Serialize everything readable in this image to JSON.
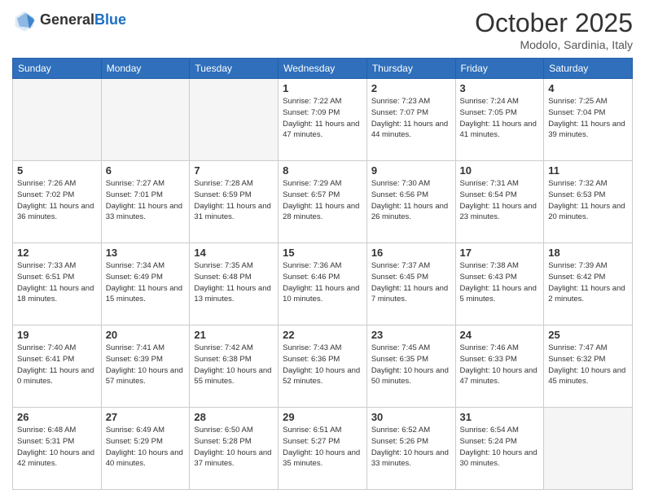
{
  "header": {
    "logo_general": "General",
    "logo_blue": "Blue",
    "month": "October 2025",
    "location": "Modolo, Sardinia, Italy"
  },
  "days_of_week": [
    "Sunday",
    "Monday",
    "Tuesday",
    "Wednesday",
    "Thursday",
    "Friday",
    "Saturday"
  ],
  "weeks": [
    [
      {
        "day": "",
        "info": ""
      },
      {
        "day": "",
        "info": ""
      },
      {
        "day": "",
        "info": ""
      },
      {
        "day": "1",
        "info": "Sunrise: 7:22 AM\nSunset: 7:09 PM\nDaylight: 11 hours and 47 minutes."
      },
      {
        "day": "2",
        "info": "Sunrise: 7:23 AM\nSunset: 7:07 PM\nDaylight: 11 hours and 44 minutes."
      },
      {
        "day": "3",
        "info": "Sunrise: 7:24 AM\nSunset: 7:05 PM\nDaylight: 11 hours and 41 minutes."
      },
      {
        "day": "4",
        "info": "Sunrise: 7:25 AM\nSunset: 7:04 PM\nDaylight: 11 hours and 39 minutes."
      }
    ],
    [
      {
        "day": "5",
        "info": "Sunrise: 7:26 AM\nSunset: 7:02 PM\nDaylight: 11 hours and 36 minutes."
      },
      {
        "day": "6",
        "info": "Sunrise: 7:27 AM\nSunset: 7:01 PM\nDaylight: 11 hours and 33 minutes."
      },
      {
        "day": "7",
        "info": "Sunrise: 7:28 AM\nSunset: 6:59 PM\nDaylight: 11 hours and 31 minutes."
      },
      {
        "day": "8",
        "info": "Sunrise: 7:29 AM\nSunset: 6:57 PM\nDaylight: 11 hours and 28 minutes."
      },
      {
        "day": "9",
        "info": "Sunrise: 7:30 AM\nSunset: 6:56 PM\nDaylight: 11 hours and 26 minutes."
      },
      {
        "day": "10",
        "info": "Sunrise: 7:31 AM\nSunset: 6:54 PM\nDaylight: 11 hours and 23 minutes."
      },
      {
        "day": "11",
        "info": "Sunrise: 7:32 AM\nSunset: 6:53 PM\nDaylight: 11 hours and 20 minutes."
      }
    ],
    [
      {
        "day": "12",
        "info": "Sunrise: 7:33 AM\nSunset: 6:51 PM\nDaylight: 11 hours and 18 minutes."
      },
      {
        "day": "13",
        "info": "Sunrise: 7:34 AM\nSunset: 6:49 PM\nDaylight: 11 hours and 15 minutes."
      },
      {
        "day": "14",
        "info": "Sunrise: 7:35 AM\nSunset: 6:48 PM\nDaylight: 11 hours and 13 minutes."
      },
      {
        "day": "15",
        "info": "Sunrise: 7:36 AM\nSunset: 6:46 PM\nDaylight: 11 hours and 10 minutes."
      },
      {
        "day": "16",
        "info": "Sunrise: 7:37 AM\nSunset: 6:45 PM\nDaylight: 11 hours and 7 minutes."
      },
      {
        "day": "17",
        "info": "Sunrise: 7:38 AM\nSunset: 6:43 PM\nDaylight: 11 hours and 5 minutes."
      },
      {
        "day": "18",
        "info": "Sunrise: 7:39 AM\nSunset: 6:42 PM\nDaylight: 11 hours and 2 minutes."
      }
    ],
    [
      {
        "day": "19",
        "info": "Sunrise: 7:40 AM\nSunset: 6:41 PM\nDaylight: 11 hours and 0 minutes."
      },
      {
        "day": "20",
        "info": "Sunrise: 7:41 AM\nSunset: 6:39 PM\nDaylight: 10 hours and 57 minutes."
      },
      {
        "day": "21",
        "info": "Sunrise: 7:42 AM\nSunset: 6:38 PM\nDaylight: 10 hours and 55 minutes."
      },
      {
        "day": "22",
        "info": "Sunrise: 7:43 AM\nSunset: 6:36 PM\nDaylight: 10 hours and 52 minutes."
      },
      {
        "day": "23",
        "info": "Sunrise: 7:45 AM\nSunset: 6:35 PM\nDaylight: 10 hours and 50 minutes."
      },
      {
        "day": "24",
        "info": "Sunrise: 7:46 AM\nSunset: 6:33 PM\nDaylight: 10 hours and 47 minutes."
      },
      {
        "day": "25",
        "info": "Sunrise: 7:47 AM\nSunset: 6:32 PM\nDaylight: 10 hours and 45 minutes."
      }
    ],
    [
      {
        "day": "26",
        "info": "Sunrise: 6:48 AM\nSunset: 5:31 PM\nDaylight: 10 hours and 42 minutes."
      },
      {
        "day": "27",
        "info": "Sunrise: 6:49 AM\nSunset: 5:29 PM\nDaylight: 10 hours and 40 minutes."
      },
      {
        "day": "28",
        "info": "Sunrise: 6:50 AM\nSunset: 5:28 PM\nDaylight: 10 hours and 37 minutes."
      },
      {
        "day": "29",
        "info": "Sunrise: 6:51 AM\nSunset: 5:27 PM\nDaylight: 10 hours and 35 minutes."
      },
      {
        "day": "30",
        "info": "Sunrise: 6:52 AM\nSunset: 5:26 PM\nDaylight: 10 hours and 33 minutes."
      },
      {
        "day": "31",
        "info": "Sunrise: 6:54 AM\nSunset: 5:24 PM\nDaylight: 10 hours and 30 minutes."
      },
      {
        "day": "",
        "info": ""
      }
    ]
  ]
}
